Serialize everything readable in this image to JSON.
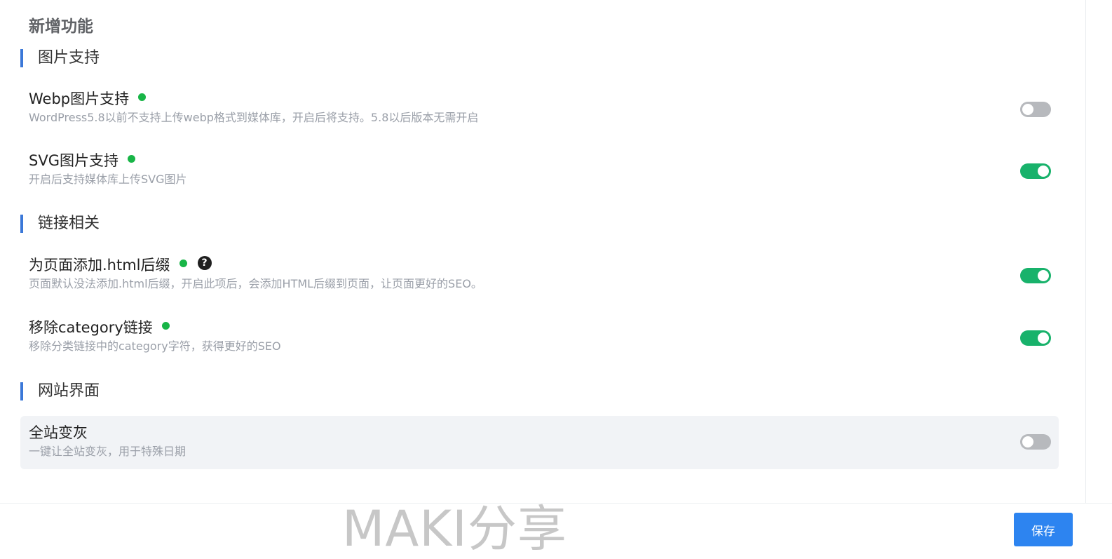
{
  "page_title": "新增功能",
  "sections": [
    {
      "title": "图片支持",
      "items": [
        {
          "title": "Webp图片支持",
          "description": "WordPress5.8以前不支持上传webp格式到媒体库，开启后将支持。5.8以后版本无需开启",
          "status_dot": true,
          "help_icon": false,
          "enabled": false
        },
        {
          "title": "SVG图片支持",
          "description": "开启后支持媒体库上传SVG图片",
          "status_dot": true,
          "help_icon": false,
          "enabled": true
        }
      ]
    },
    {
      "title": "链接相关",
      "items": [
        {
          "title": "为页面添加.html后缀",
          "description": "页面默认没法添加.html后缀，开启此项后，会添加HTML后缀到页面，让页面更好的SEO。",
          "status_dot": true,
          "help_icon": true,
          "enabled": true
        },
        {
          "title": "移除category链接",
          "description": "移除分类链接中的category字符，获得更好的SEO",
          "status_dot": true,
          "help_icon": false,
          "enabled": true
        }
      ]
    },
    {
      "title": "网站界面",
      "items": [
        {
          "title": "全站变灰",
          "description": "一键让全站变灰，用于特殊日期",
          "status_dot": false,
          "help_icon": false,
          "enabled": false
        }
      ]
    }
  ],
  "help_glyph": "?",
  "watermark": "MAKI分享",
  "save_label": "保存",
  "colors": {
    "accent": "#3b78d8",
    "toggle_on": "#18b26b",
    "toggle_off": "#b7b9bd",
    "status_dot": "#18b547",
    "save_button": "#2d84f0"
  },
  "icons": {
    "status": "status-dot-icon",
    "help": "question-circle-icon"
  }
}
